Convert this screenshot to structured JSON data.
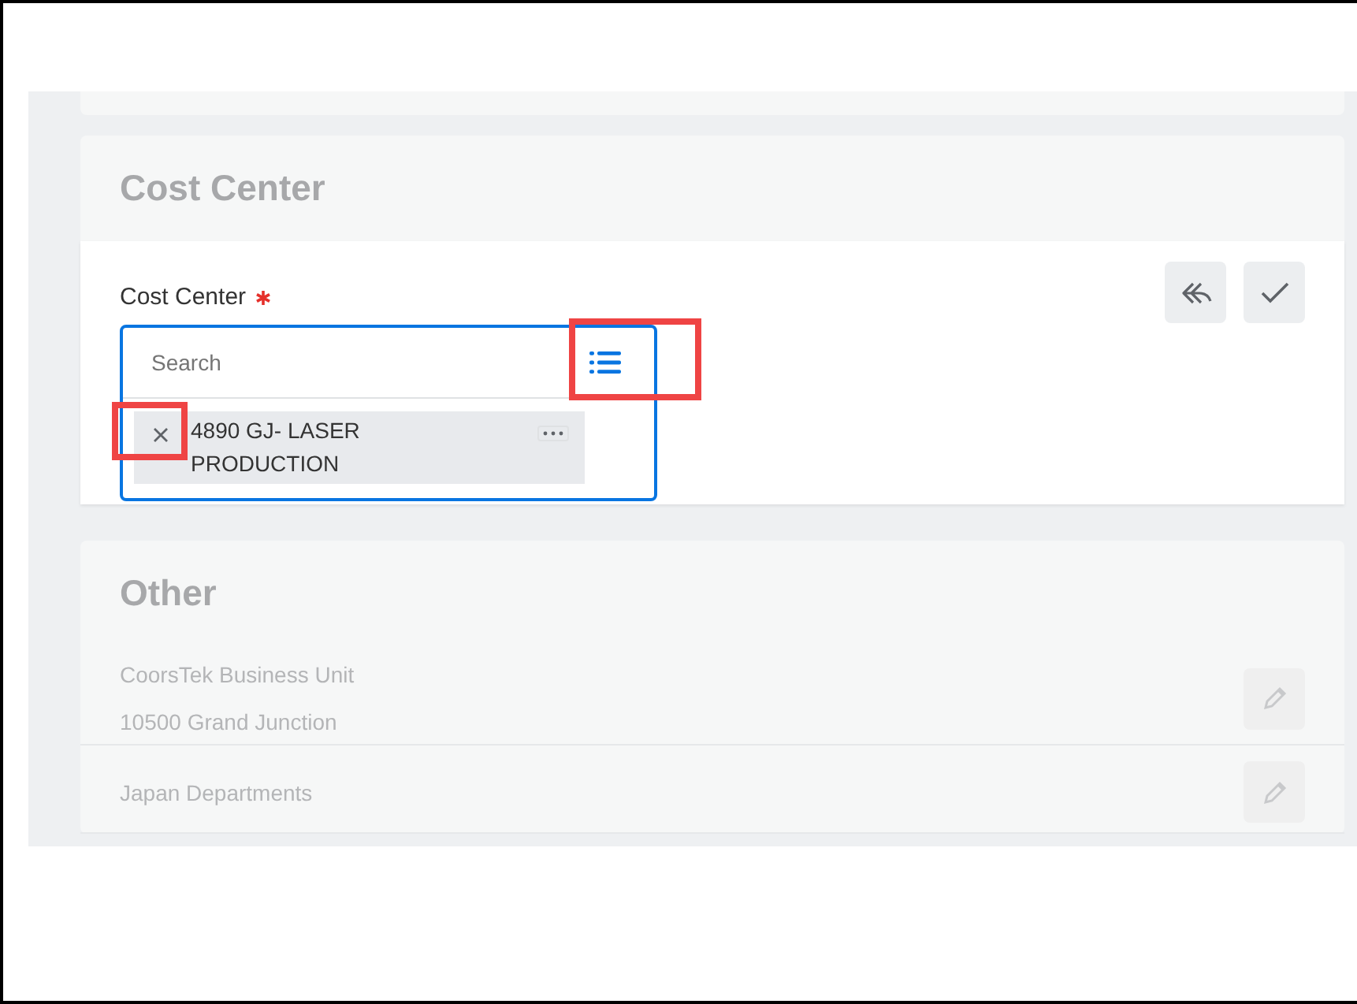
{
  "sections": [
    {
      "kind": "edit",
      "title": "Cost Center",
      "field": {
        "label": "Cost Center",
        "required": true,
        "placeholder": "Search",
        "prompt_highlighted": true,
        "selected_items": [
          {
            "label": "4890 GJ- LASER PRODUCTION",
            "remove_highlighted": true
          }
        ]
      }
    },
    {
      "kind": "view",
      "title": "Other",
      "rows": [
        {
          "lines": [
            "CoorsTek Business Unit",
            "10500 Grand Junction"
          ]
        },
        {
          "lines": [
            "Japan Departments"
          ]
        }
      ]
    }
  ]
}
